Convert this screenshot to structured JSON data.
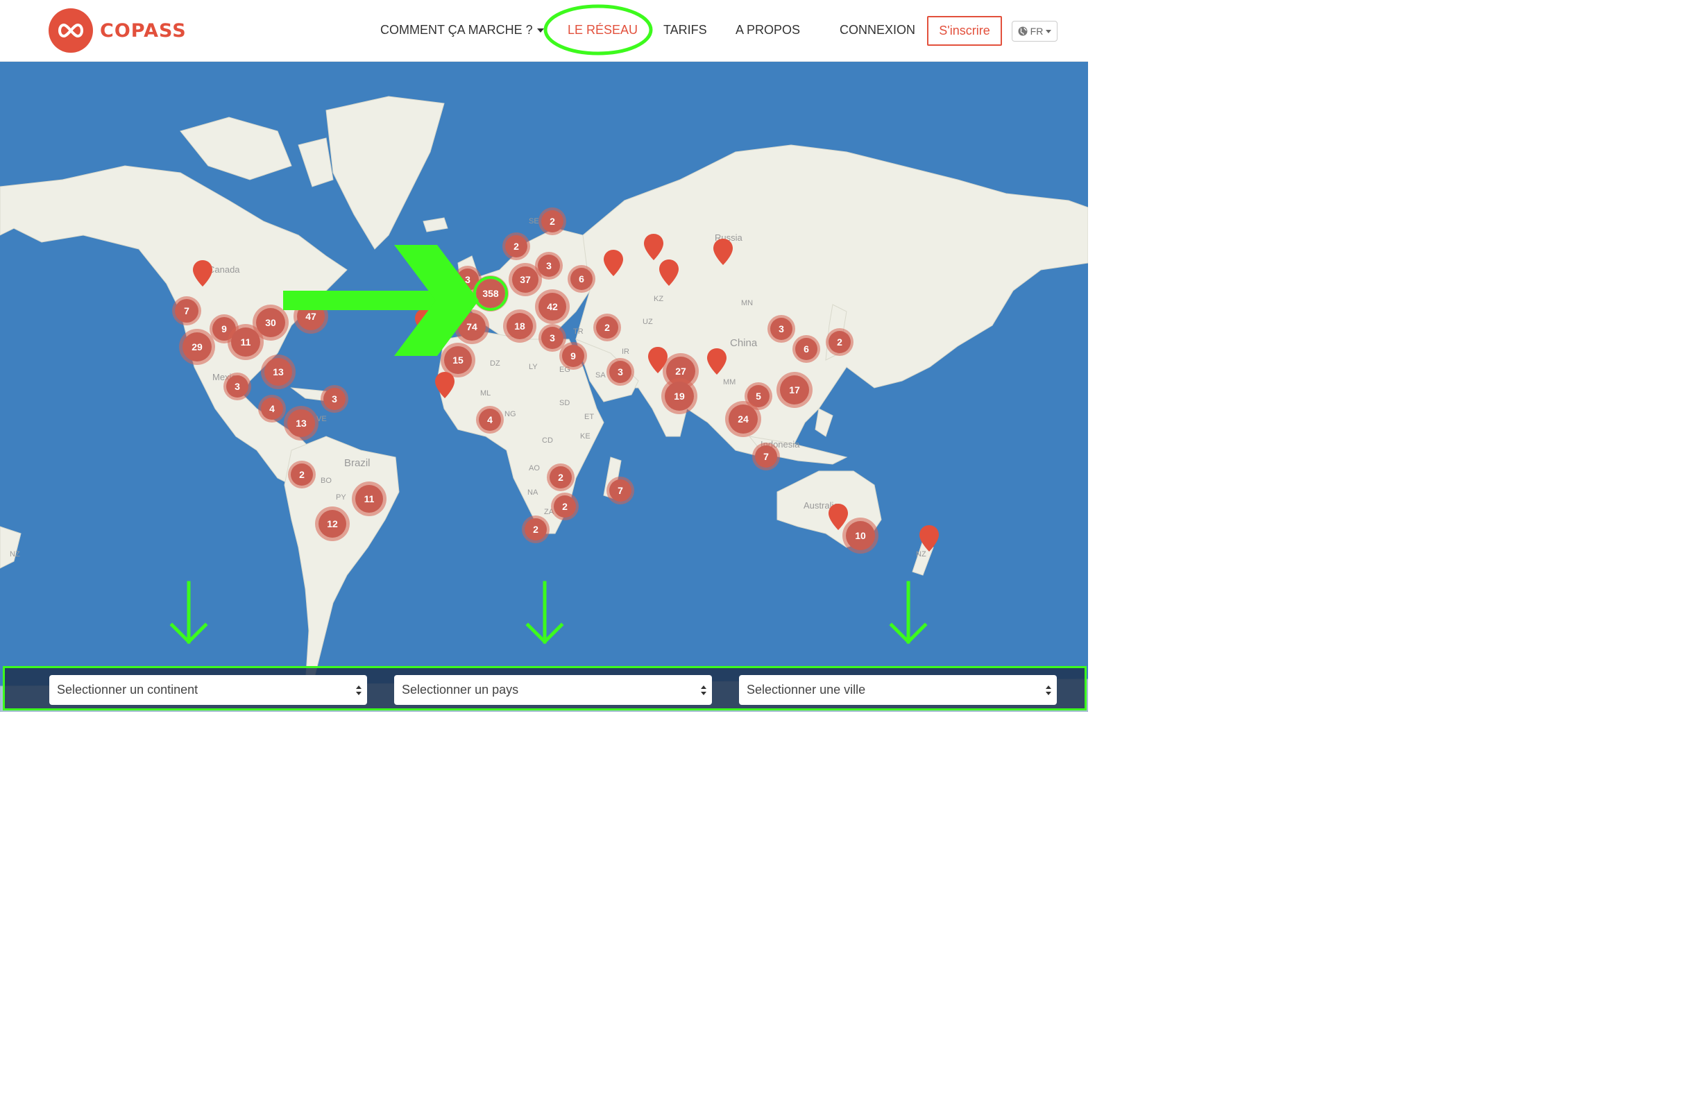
{
  "brand": {
    "name": "COPASS"
  },
  "nav": {
    "how_it_works": "COMMENT ÇA MARCHE ?",
    "network": "LE RÉSEAU",
    "pricing": "TARIFS",
    "about": "A PROPOS",
    "login": "CONNEXION",
    "signup": "S'inscrire",
    "language": "FR"
  },
  "map": {
    "labels": [
      "Canada",
      "Mexico",
      "Brazil",
      "Russia",
      "China",
      "Australia",
      "Indonesia",
      "SE",
      "KZ",
      "MN",
      "UZ",
      "IR",
      "TR",
      "EG",
      "LY",
      "DZ",
      "ML",
      "NG",
      "SD",
      "ET",
      "CD",
      "KE",
      "AO",
      "NA",
      "ZA",
      "SA",
      "MM",
      "BO",
      "PY",
      "VE",
      "NZ"
    ],
    "clusters": [
      "2",
      "2",
      "3",
      "37",
      "6",
      "3",
      "358",
      "42",
      "74",
      "18",
      "3",
      "2",
      "9",
      "15",
      "3",
      "7",
      "9",
      "30",
      "47",
      "29",
      "11",
      "13",
      "3",
      "4",
      "13",
      "3",
      "2",
      "11",
      "12",
      "4",
      "2",
      "2",
      "2",
      "7",
      "3",
      "6",
      "2",
      "27",
      "19",
      "5",
      "17",
      "24",
      "7",
      "10"
    ]
  },
  "filters": {
    "continent": "Selectionner un continent",
    "country": "Selectionner un pays",
    "city": "Selectionner une ville"
  },
  "colors": {
    "brand": "#e2503c",
    "ocean": "#3f80bf",
    "land": "#efefe6",
    "annotation": "#3dfa1d"
  }
}
